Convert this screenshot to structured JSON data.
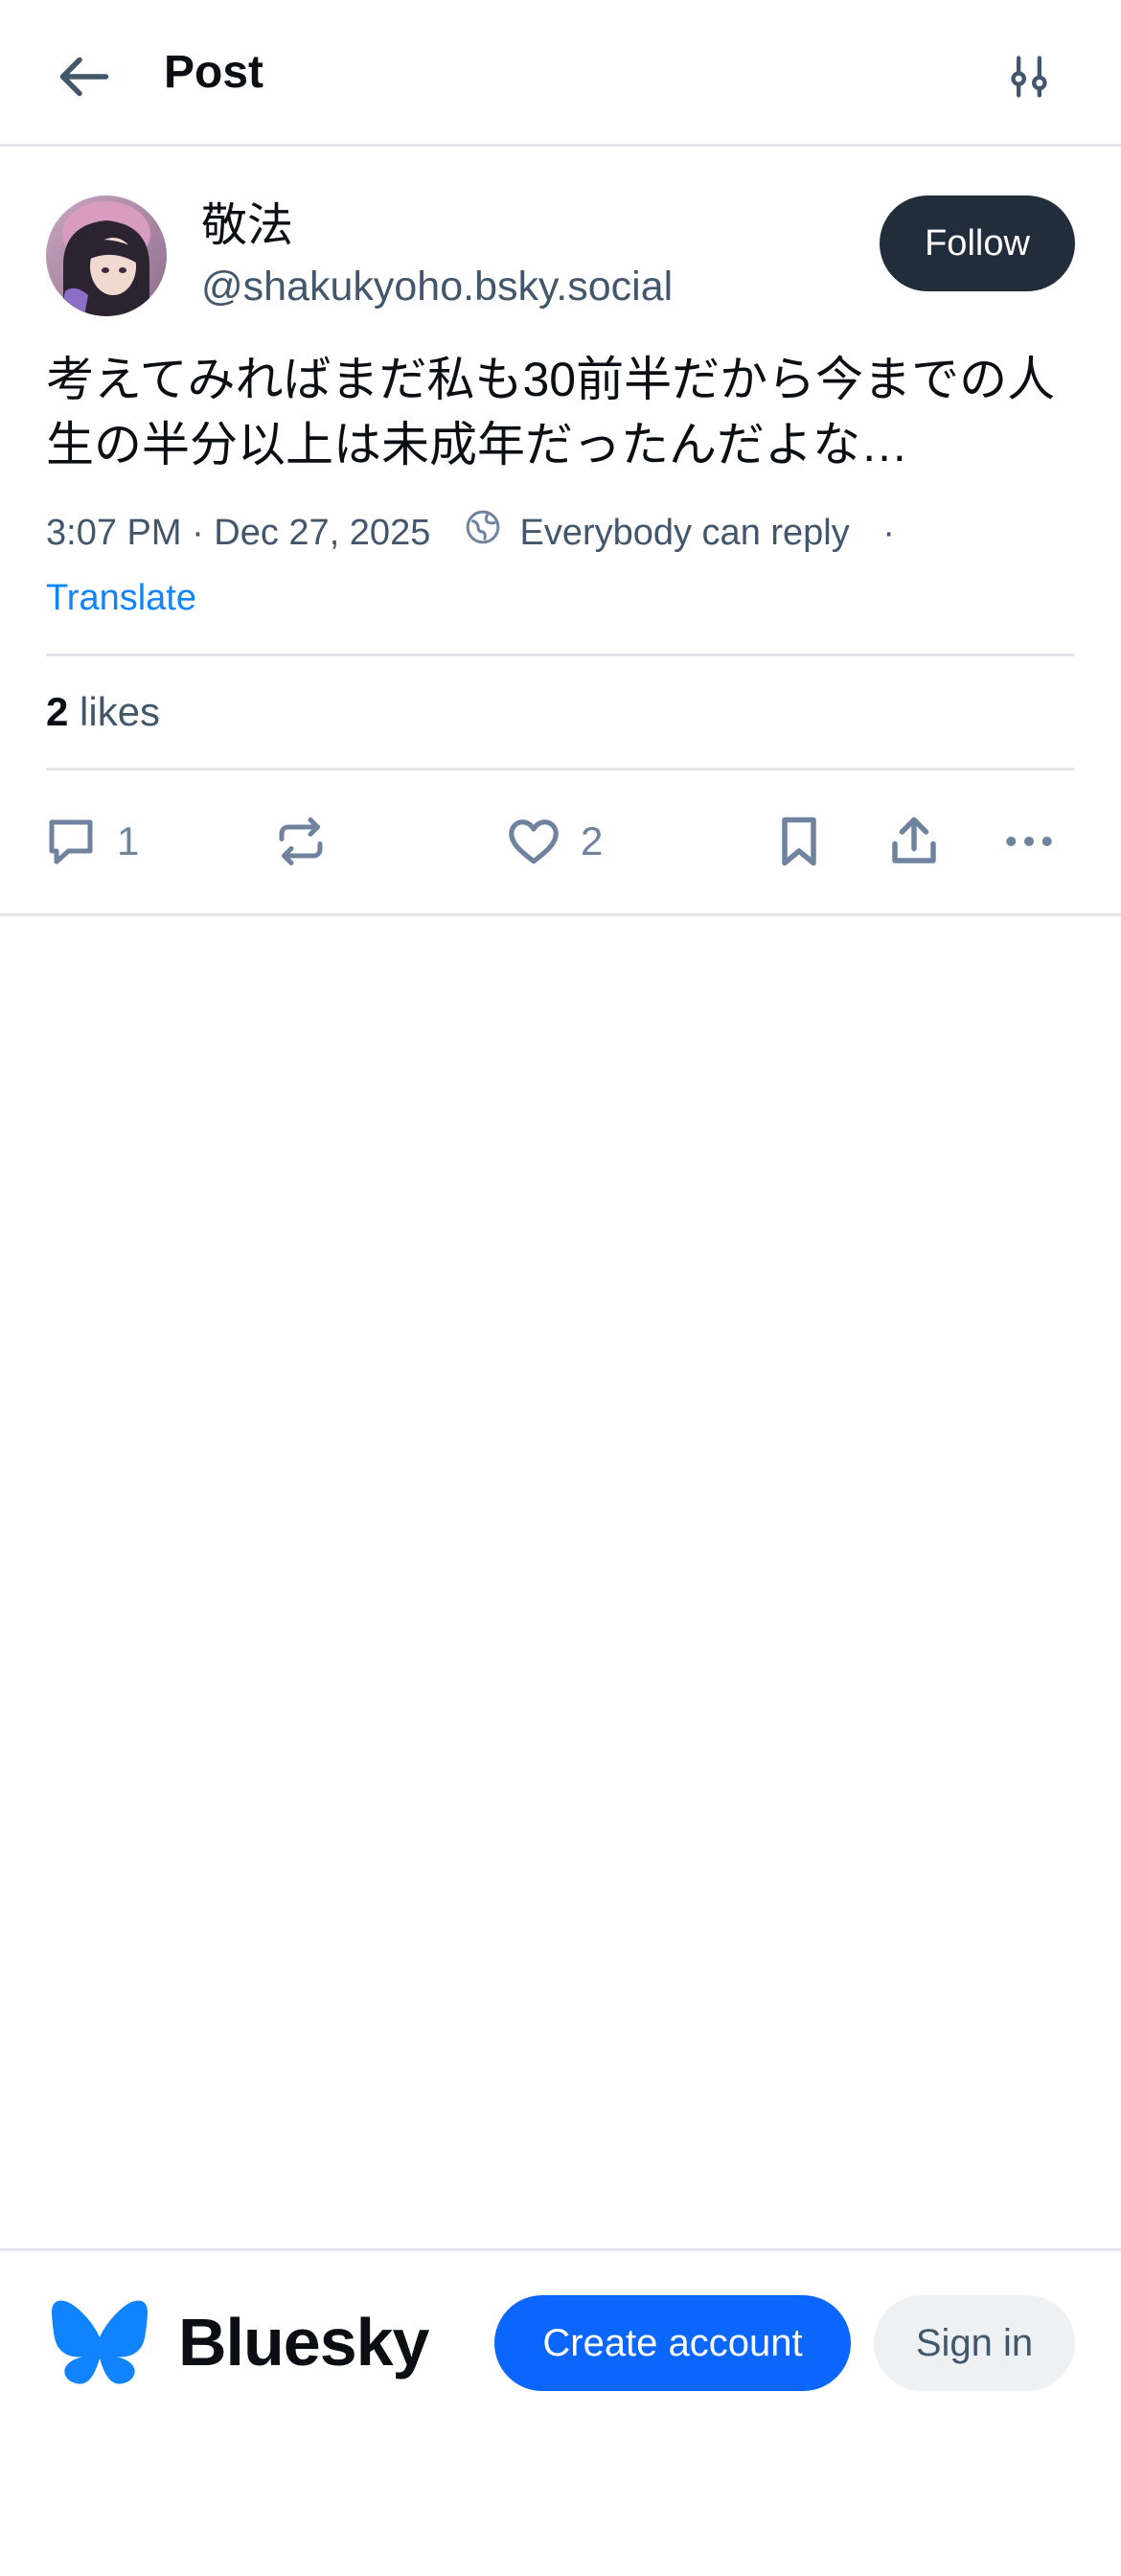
{
  "header": {
    "title": "Post",
    "back_icon": "arrow-left-icon",
    "filter_icon": "sliders-icon"
  },
  "post": {
    "author": {
      "name": "敬法",
      "handle": "@shakukyoho.bsky.social"
    },
    "follow_label": "Follow",
    "text": "考えてみればまだ私も30前半だから今までの人生の半分以上は未成年だったんだよな…",
    "timestamp": "3:07 PM · Dec 27, 2025",
    "reply_setting": "Everybody can reply",
    "separator": "·",
    "translate_label": "Translate",
    "likes": {
      "count": "2",
      "label": "likes"
    },
    "actions": {
      "reply_count": "1",
      "like_count": "2"
    }
  },
  "footer": {
    "brand": "Bluesky",
    "create_account_label": "Create account",
    "sign_in_label": "Sign in"
  },
  "colors": {
    "accent": "#0a66ff",
    "link": "#1083fe",
    "follow_bg": "#212d3b",
    "muted_text": "#42576c",
    "icon": "#6f839f",
    "divider": "#e3e7ec"
  }
}
